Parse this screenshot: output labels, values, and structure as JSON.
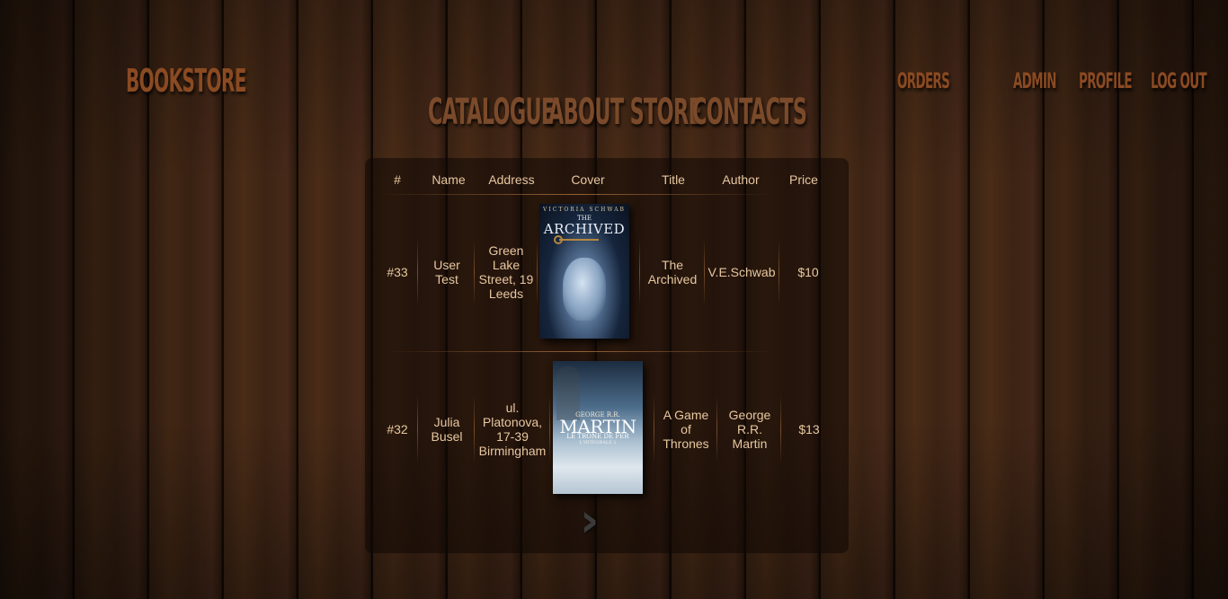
{
  "header": {
    "logo": "BOOKSTORE",
    "main_nav": [
      "CATALOGUE",
      "ABOUT STORE",
      "CONTACTS"
    ],
    "top_nav": [
      "ORDERS",
      "ADMIN",
      "PROFILE",
      "LOG OUT"
    ]
  },
  "table": {
    "columns": [
      "#",
      "Name",
      "Address",
      "Cover",
      "Title",
      "Author",
      "Price"
    ],
    "rows": [
      {
        "id": "#33",
        "name": "User Test",
        "address": "Green Lake Street, 19 Leeds",
        "cover": {
          "author_line": "VICTORIA SCHWAB",
          "title_line_1": "THE",
          "title_line_2": "ARCHIVED"
        },
        "title": "The Archived",
        "author": "V.E.Schwab",
        "price": "$10"
      },
      {
        "id": "#32",
        "name": "Julia Busel",
        "address": "ul. Platonova, 17-39 Birmingham",
        "cover": {
          "author_line": "GEORGE R.R.",
          "title_line_1": "MARTIN",
          "title_line_2": "LE TRÔNE DE FER",
          "title_line_3": "L'INTÉGRALE 1"
        },
        "title": "A Game of Thrones",
        "author": "George R.R. Martin",
        "price": "$13"
      }
    ]
  },
  "pagination": {
    "next_icon": "chevron-right-icon",
    "next_glyph": "›"
  }
}
